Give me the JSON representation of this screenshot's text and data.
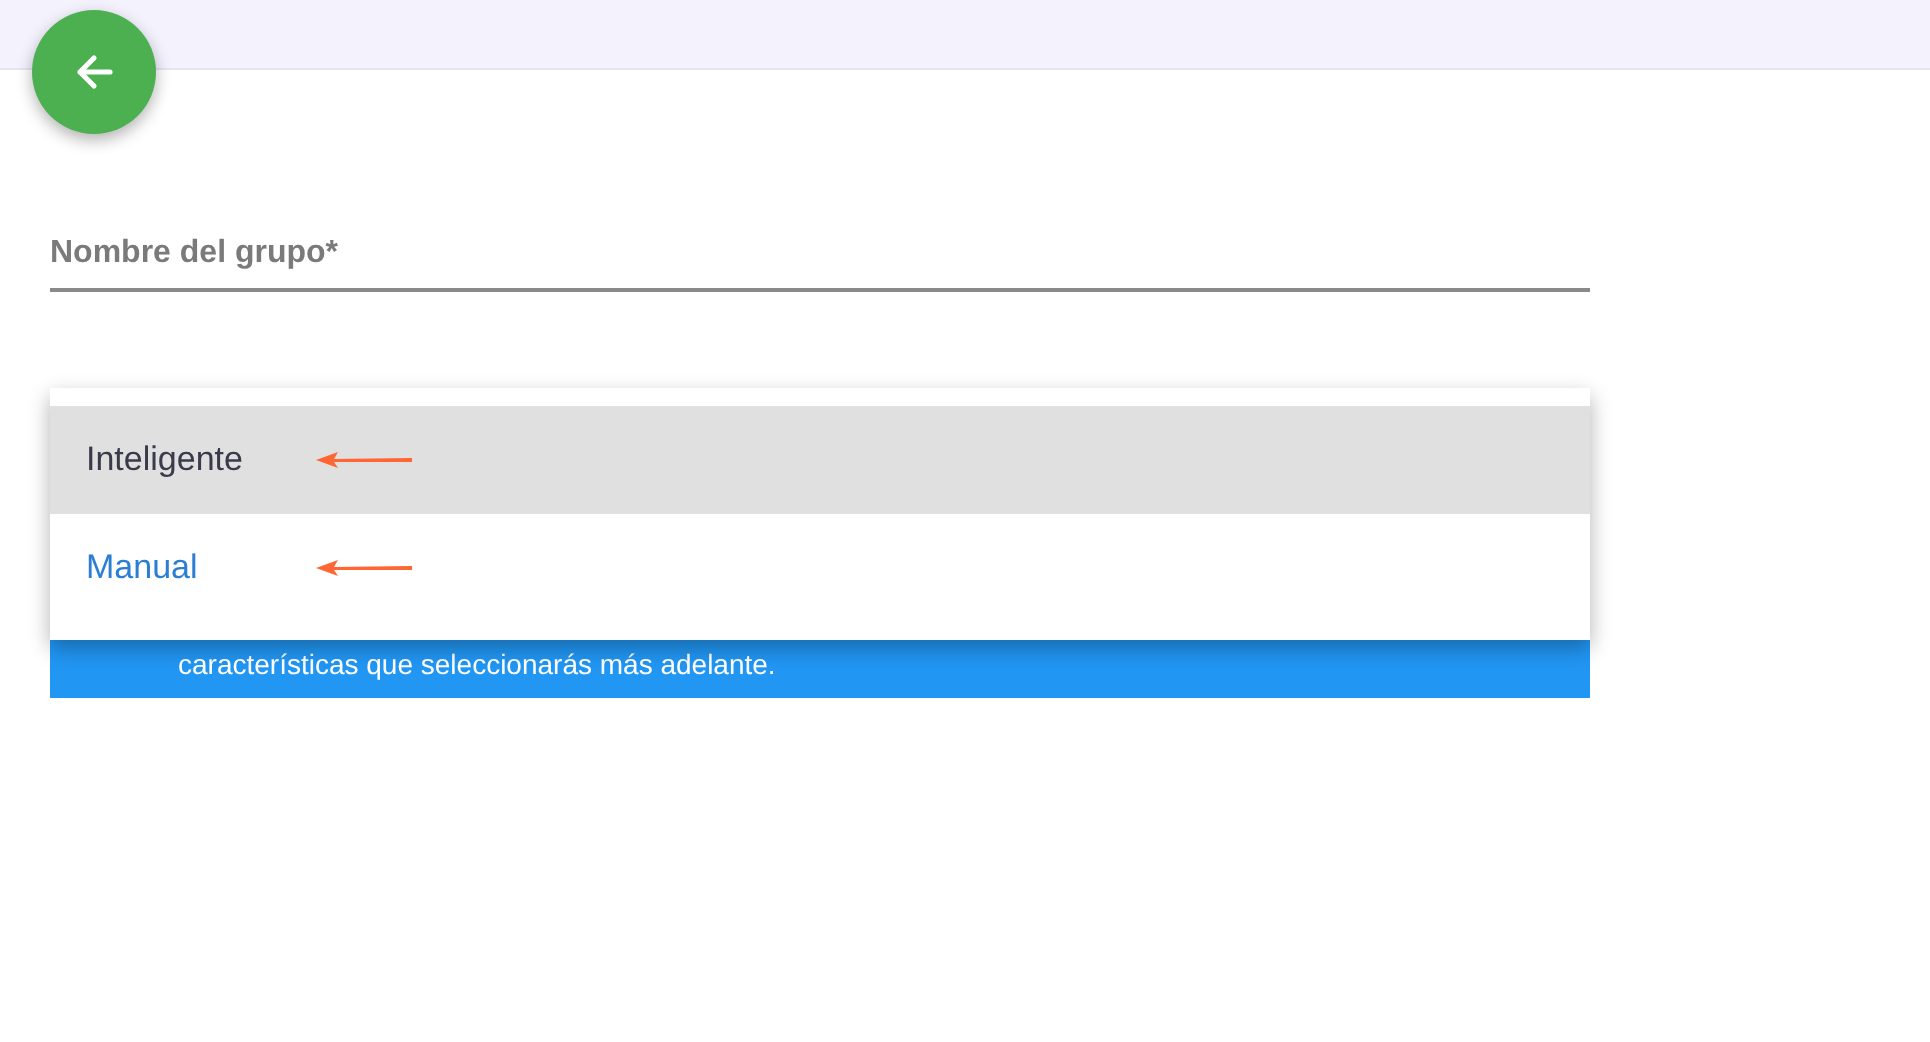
{
  "name_field": {
    "placeholder": "Nombre del grupo*"
  },
  "type_menu": {
    "options": [
      {
        "label": "Inteligente",
        "selected": false,
        "highlighted": true,
        "marked": true
      },
      {
        "label": "Manual",
        "selected": true,
        "highlighted": false,
        "marked": true
      }
    ]
  },
  "info_banner": {
    "text": "características que seleccionarás más adelante."
  }
}
